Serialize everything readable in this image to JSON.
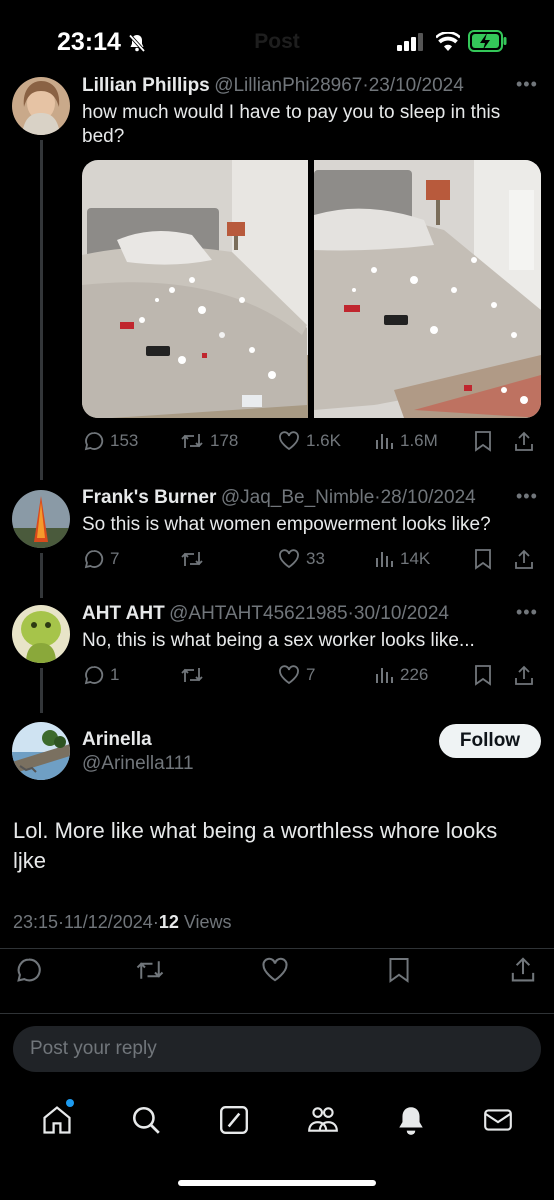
{
  "header": {
    "title": "Post"
  },
  "status_bar": {
    "time": "23:14"
  },
  "thread": [
    {
      "name": "Lillian Phillips",
      "handle": "@LillianPhi28967",
      "date": "23/10/2024",
      "text": "how much would I have to pay you to sleep in this bed?",
      "replies": "153",
      "reposts": "178",
      "likes": "1.6K",
      "views": "1.6M"
    },
    {
      "name": "Frank's Burner",
      "handle": "@Jaq_Be_Nimble",
      "date": "28/10/2024",
      "text": "So this is what women empowerment looks like?",
      "replies": "7",
      "reposts": "",
      "likes": "33",
      "views": "14K"
    },
    {
      "name": "AHT AHT",
      "handle": "@AHTAHT45621985",
      "date": "30/10/2024",
      "text": "No, this is what being a sex worker looks like...",
      "replies": "1",
      "reposts": "",
      "likes": "7",
      "views": "226"
    }
  ],
  "main_post": {
    "name": "Arinella",
    "handle": "@Arinella111",
    "follow_label": "Follow",
    "text": "Lol. More like what being a worthless whore looks ljke",
    "time": "23:15",
    "date": "11/12/2024",
    "views_count": "12",
    "views_label": "Views"
  },
  "reply_box": {
    "placeholder": "Post your reply"
  },
  "separator": "·",
  "colors": {
    "background": "#000000",
    "text": "#e7e9ea",
    "muted": "#71767b",
    "accent": "#1d9bf0",
    "battery": "#34c759"
  }
}
